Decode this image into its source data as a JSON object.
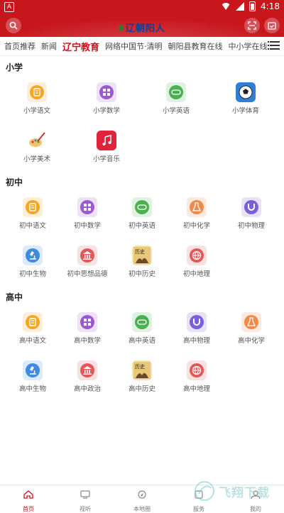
{
  "status_bar": {
    "time": "4:18",
    "left_glyph": "A"
  },
  "header": {
    "logo_text": "辽朝阳人"
  },
  "tabs": [
    "首页推荐",
    "新闻",
    "辽宁教育",
    "网络中国节·清明",
    "朝阳县教育在线",
    "中小学在线"
  ],
  "sections": [
    {
      "title": "小学",
      "items": [
        {
          "label": "小学语文",
          "icon": "chinese-book-icon",
          "color": "#f5a623"
        },
        {
          "label": "小学数学",
          "icon": "math-grid-icon",
          "color": "#9b59d0"
        },
        {
          "label": "小学英语",
          "icon": "english-abc-icon",
          "color": "#4caf50"
        },
        {
          "label": "小学体育",
          "icon": "soccer-ball-icon",
          "color": "#2f7fd8"
        },
        {
          "label": "小学美术",
          "icon": "paint-palette-icon",
          "color": "#e04040"
        },
        {
          "label": "小学音乐",
          "icon": "music-note-icon",
          "color": "#e0233a"
        }
      ]
    },
    {
      "title": "初中",
      "items": [
        {
          "label": "初中语文",
          "icon": "chinese-book-icon",
          "color": "#f5a623"
        },
        {
          "label": "初中数学",
          "icon": "math-grid-icon",
          "color": "#9b59d0"
        },
        {
          "label": "初中英语",
          "icon": "english-abc-icon",
          "color": "#4caf50"
        },
        {
          "label": "初中化学",
          "icon": "flask-icon",
          "color": "#f08a4b"
        },
        {
          "label": "初中物理",
          "icon": "magnet-icon",
          "color": "#7b5fd6"
        },
        {
          "label": "初中生物",
          "icon": "microscope-icon",
          "color": "#3f8be0"
        },
        {
          "label": "初中思想品德",
          "icon": "building-icon",
          "color": "#e05858"
        },
        {
          "label": "初中历史",
          "icon": "history-book-icon",
          "color": "#c89a3a"
        },
        {
          "label": "初中地理",
          "icon": "globe-icon",
          "color": "#e05858"
        }
      ]
    },
    {
      "title": "高中",
      "items": [
        {
          "label": "高中语文",
          "icon": "chinese-book-icon",
          "color": "#f5a623"
        },
        {
          "label": "高中数学",
          "icon": "math-grid-icon",
          "color": "#9b59d0"
        },
        {
          "label": "高中英语",
          "icon": "english-abc-icon",
          "color": "#4caf50"
        },
        {
          "label": "高中物理",
          "icon": "magnet-icon",
          "color": "#7b5fd6"
        },
        {
          "label": "高中化学",
          "icon": "flask-icon",
          "color": "#f08a4b"
        },
        {
          "label": "高中生物",
          "icon": "microscope-icon",
          "color": "#3f8be0"
        },
        {
          "label": "高中政治",
          "icon": "building-icon",
          "color": "#e05858"
        },
        {
          "label": "高中历史",
          "icon": "history-book-icon",
          "color": "#c89a3a"
        },
        {
          "label": "高中地理",
          "icon": "globe-icon",
          "color": "#e05858"
        }
      ]
    }
  ],
  "bottom_nav": [
    {
      "label": "首页",
      "icon": "home-icon"
    },
    {
      "label": "视听",
      "icon": "tv-icon"
    },
    {
      "label": "本地圈",
      "icon": "location-icon"
    },
    {
      "label": "服务",
      "icon": "service-icon"
    },
    {
      "label": "我的",
      "icon": "user-icon"
    }
  ],
  "watermark_text": "飞翔下载",
  "colors": {
    "brand_red": "#c8161d",
    "active_red": "#d0121b"
  }
}
